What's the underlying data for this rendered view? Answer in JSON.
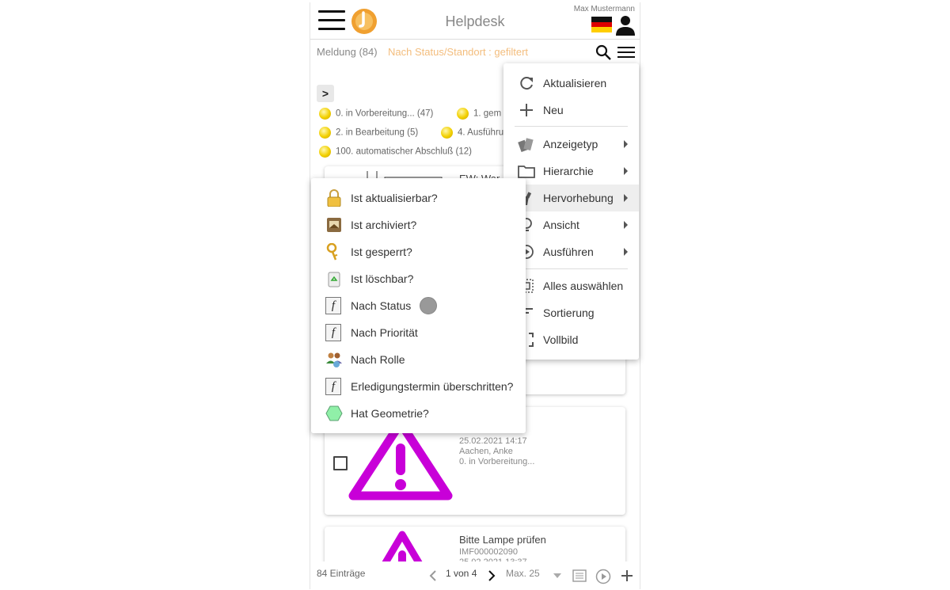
{
  "header": {
    "title": "Helpdesk",
    "user_name": "Max Mustermann"
  },
  "subbar": {
    "meldung": "Meldung (84)",
    "filter": "Nach Status/Standort : gefiltert"
  },
  "status_legend": [
    {
      "label": "0. in Vorbereitung... (47)"
    },
    {
      "label": "1. gem"
    },
    {
      "label": "2. in Bearbeitung (5)"
    },
    {
      "label": "4. Ausführu"
    },
    {
      "label": "100. automatischer Abschluß (12)"
    }
  ],
  "cards": [
    {
      "title_fragment": "EW: War"
    },
    {
      "date": "25.02.2021 14:17",
      "person": "Aachen, Anke",
      "status": "0. in Vorbereitung..."
    },
    {
      "title": "Bitte Lampe prüfen",
      "id": "IMF000002090",
      "date": "25.02.2021 13:37"
    }
  ],
  "footer": {
    "count": "84 Einträge",
    "page": "1 von 4",
    "max": "Max. 25"
  },
  "context_menu": [
    {
      "label": "Aktualisieren",
      "icon": "refresh-icon"
    },
    {
      "label": "Neu",
      "icon": "plus-icon"
    },
    {
      "label": "Anzeigetyp",
      "icon": "display-type-icon",
      "submenu": true
    },
    {
      "label": "Hierarchie",
      "icon": "folder-icon",
      "submenu": true
    },
    {
      "label": "Hervorhebung",
      "icon": "highlight-icon",
      "submenu": true,
      "active": true
    },
    {
      "label": "Ansicht",
      "icon": "bulb-icon",
      "submenu": true
    },
    {
      "label": "Ausführen",
      "icon": "play-icon",
      "submenu": true
    },
    {
      "label": "Alles auswählen",
      "icon": "select-all-icon"
    },
    {
      "label": "Sortierung",
      "icon": "sort-icon"
    },
    {
      "label": "Vollbild",
      "icon": "fullscreen-icon"
    }
  ],
  "submenu": [
    {
      "label": "Ist aktualisierbar?",
      "icon": "lock-icon"
    },
    {
      "label": "Ist archiviert?",
      "icon": "archive-icon"
    },
    {
      "label": "Ist gesperrt?",
      "icon": "keys-icon"
    },
    {
      "label": "Ist löschbar?",
      "icon": "recycle-bin-icon"
    },
    {
      "label": "Nach Status",
      "icon": "function-icon",
      "selected": true
    },
    {
      "label": "Nach Priorität",
      "icon": "function-icon"
    },
    {
      "label": "Nach Rolle",
      "icon": "users-icon"
    },
    {
      "label": "Erledigungstermin überschritten?",
      "icon": "function-icon"
    },
    {
      "label": "Hat Geometrie?",
      "icon": "hexagon-icon"
    }
  ],
  "colors": {
    "accent_orange": "#f3bd7d",
    "warning_magenta": "#c800d8",
    "status_yellow": "#f2d000"
  }
}
